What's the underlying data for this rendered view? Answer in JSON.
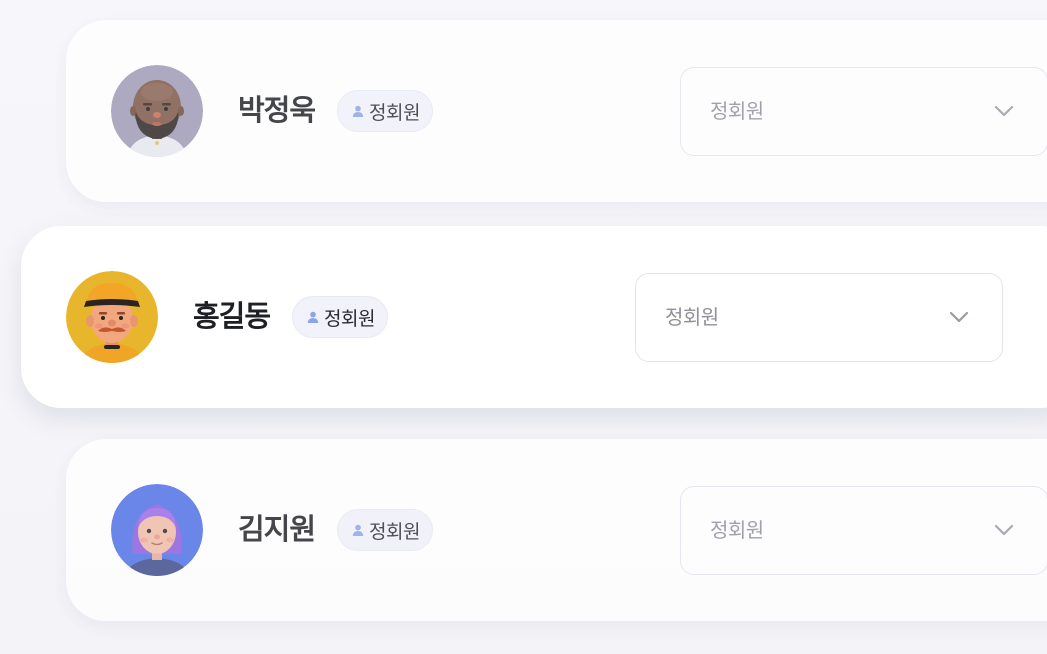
{
  "members": [
    {
      "name": "박정욱",
      "badge": "정회원",
      "selected_role": "정회원",
      "avatar": "bald-bearded-man-avatar",
      "avatar_bg": "#9c99b4",
      "state": "inactive"
    },
    {
      "name": "홍길동",
      "badge": "정회원",
      "selected_role": "정회원",
      "avatar": "cap-mustache-man-avatar",
      "avatar_bg": "#e8b62c",
      "state": "active"
    },
    {
      "name": "김지원",
      "badge": "정회원",
      "selected_role": "정회원",
      "avatar": "purple-hair-woman-avatar",
      "avatar_bg": "#4e6fe6",
      "state": "inactive"
    }
  ],
  "icons": {
    "badge": "person-icon",
    "dropdown": "chevron-down-icon"
  },
  "colors": {
    "badge_icon": "#8ea4e8",
    "card_bg": "#ffffff",
    "page_bg": "#f4f4f8"
  }
}
